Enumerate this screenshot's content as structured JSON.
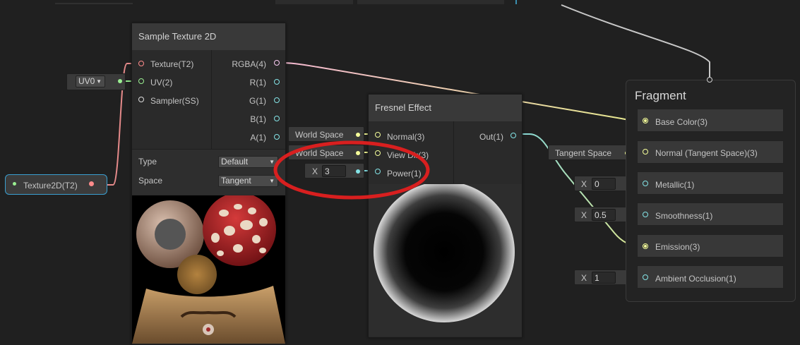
{
  "sample_texture": {
    "title": "Sample Texture 2D",
    "inputs": [
      "Texture(T2)",
      "UV(2)",
      "Sampler(SS)"
    ],
    "outputs": [
      "RGBA(4)",
      "R(1)",
      "G(1)",
      "B(1)",
      "A(1)"
    ],
    "type_label": "Type",
    "type_value": "Default",
    "space_label": "Space",
    "space_value": "Tangent"
  },
  "uv_node": {
    "value": "UV0"
  },
  "texture_property": {
    "label": "Texture2D(T2)"
  },
  "fresnel": {
    "title": "Fresnel Effect",
    "inputs": [
      "Normal(3)",
      "View Dir(3)",
      "Power(1)"
    ],
    "output": "Out(1)",
    "normal_space": "World Space",
    "view_space": "World Space",
    "power_axis": "X",
    "power_value": "3"
  },
  "fragment": {
    "title": "Fragment",
    "slots": [
      "Base Color(3)",
      "Normal (Tangent Space)(3)",
      "Metallic(1)",
      "Smoothness(1)",
      "Emission(3)",
      "Ambient Occlusion(1)"
    ],
    "normal_space": "Tangent Space",
    "metallic": {
      "axis": "X",
      "value": "0"
    },
    "smoothness": {
      "axis": "X",
      "value": "0.5"
    },
    "ambient_occlusion": {
      "axis": "X",
      "value": "1"
    }
  },
  "colors": {
    "background": "#202020",
    "node_title": "#393939",
    "node_body": "#2a2a2a",
    "vector1_port": "#84e4e7",
    "vector3_port": "#f6ff9a",
    "vector4_port": "#fbcbf4",
    "texture_port": "#ff8b8b",
    "vector2_port": "#9aef92",
    "annotation": "#d81f1f"
  }
}
